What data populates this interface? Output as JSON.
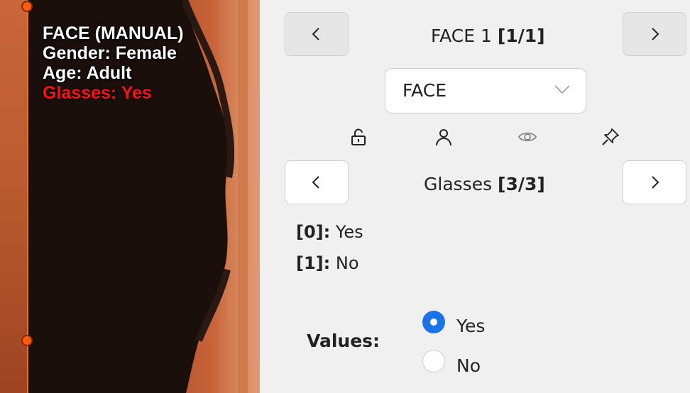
{
  "overlay": {
    "title": "FACE (MANUAL)",
    "gender": "Gender: Female",
    "age": "Age: Adult",
    "glasses": "Glasses: Yes"
  },
  "face_nav": {
    "label": "FACE 1 ",
    "counter": "[1/1]",
    "prev_icon": "chevron-left-icon",
    "next_icon": "chevron-right-icon"
  },
  "dropdown": {
    "selected": "FACE",
    "icon": "chevron-down-icon"
  },
  "toolbar": {
    "icons": [
      "unlock-icon",
      "user-icon",
      "eye-icon",
      "pin-icon"
    ]
  },
  "attr_nav": {
    "label": "Glasses ",
    "counter": "[3/3]"
  },
  "options": [
    {
      "index": "[0]:",
      "text": " Yes"
    },
    {
      "index": "[1]:",
      "text": " No"
    }
  ],
  "values": {
    "label": "Values:",
    "choices": [
      {
        "label": "Yes",
        "selected": true
      },
      {
        "label": "No",
        "selected": false
      }
    ],
    "accent": "#1a73e8"
  },
  "colors": {
    "bbox": "#ff6a1a",
    "highlight_text": "#ff1010"
  }
}
